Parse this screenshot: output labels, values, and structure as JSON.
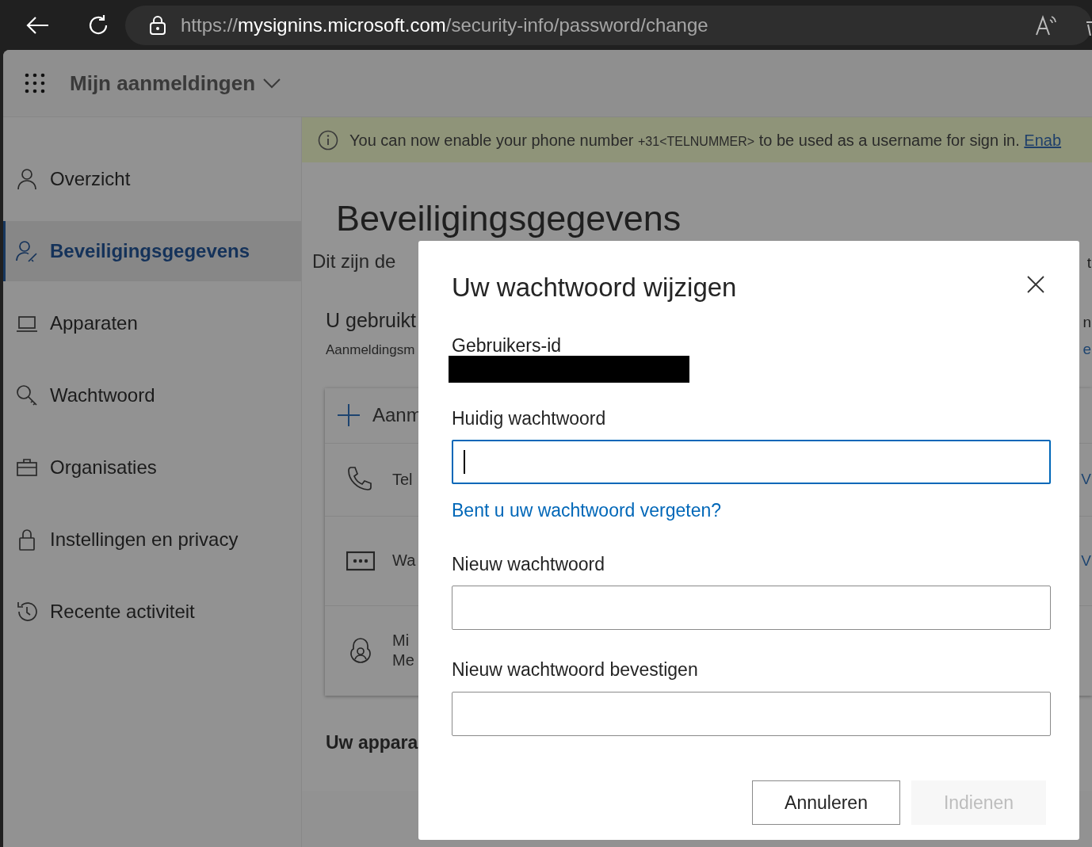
{
  "browser": {
    "url_scheme": "https://",
    "url_host": "mysignins.microsoft.com",
    "url_path": "/security-info/password/change"
  },
  "header": {
    "app_title": "Mijn aanmeldingen"
  },
  "sidebar": {
    "items": [
      {
        "label": "Overzicht",
        "selected": false
      },
      {
        "label": "Beveiligingsgegevens",
        "selected": true
      },
      {
        "label": "Apparaten",
        "selected": false
      },
      {
        "label": "Wachtwoord",
        "selected": false
      },
      {
        "label": "Organisaties",
        "selected": false
      },
      {
        "label": "Instellingen en privacy",
        "selected": false
      },
      {
        "label": "Recente activiteit",
        "selected": false
      }
    ]
  },
  "banner": {
    "text_before": "You can now enable your phone number ",
    "phone": "+31<TELNUMMER>",
    "text_after": " to be used as a username for sign in.",
    "link": "Enab"
  },
  "main": {
    "title": "Beveiligingsgegevens",
    "lines": [
      {
        "kind": "intro",
        "text": "Dit zijn de",
        "right": "t"
      },
      {
        "kind": "heading",
        "text": "U gebruikt",
        "right": "n"
      },
      {
        "kind": "sub",
        "text": "Aanmeldingsm",
        "right": "e"
      }
    ],
    "methods": {
      "add_label": "Aanm",
      "rows": [
        {
          "lines": [
            "Tel"
          ],
          "right": "V"
        },
        {
          "lines": [
            "Wa"
          ],
          "right": "V"
        },
        {
          "lines": [
            "Mi",
            "Me"
          ]
        }
      ]
    },
    "devices_heading": "Uw appara"
  },
  "dialog": {
    "title": "Uw wachtwoord wijzigen",
    "user_id": {
      "label": "Gebruikers-id",
      "redacted": true
    },
    "fields": [
      {
        "label": "Huidig wachtwoord",
        "focused": true,
        "link": "Bent u uw wachtwoord vergeten?"
      },
      {
        "label": "Nieuw wachtwoord",
        "focused": false
      },
      {
        "label": "Nieuw wachtwoord bevestigen",
        "focused": false
      }
    ],
    "buttons": [
      {
        "label": "Annuleren",
        "disabled": false
      },
      {
        "label": "Indienen",
        "disabled": true
      }
    ]
  }
}
